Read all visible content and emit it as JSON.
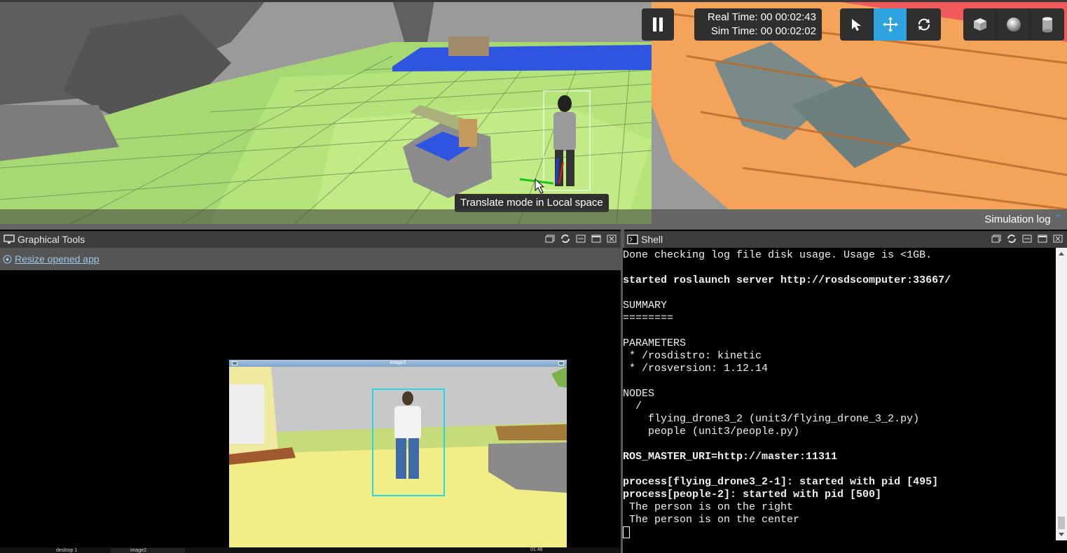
{
  "viewport": {
    "real_time": "Real Time: 00 00:02:43",
    "sim_time": "Sim Time: 00 00:02:02",
    "tooltip": "Translate mode in Local space",
    "simulation_log": "Simulation log",
    "tools": [
      "select-icon",
      "translate-icon",
      "rotate-icon"
    ],
    "shapes": [
      "box-icon",
      "sphere-icon",
      "cylinder-icon"
    ],
    "active_color": "#2ea3df"
  },
  "graphical_tools": {
    "title": "Graphical Tools",
    "resize_link": "Resize opened app",
    "image_window_title": "image2",
    "taskbar_items": [
      "desktop 1",
      "image2"
    ],
    "taskbar_time": "01:46"
  },
  "shell": {
    "title": "Shell",
    "lines": [
      {
        "text": "Done checking log file disk usage. Usage is <1GB.",
        "bold": false
      },
      {
        "text": "",
        "bold": false
      },
      {
        "text": "started roslaunch server http://rosdscomputer:33667/",
        "bold": true
      },
      {
        "text": "",
        "bold": false
      },
      {
        "text": "SUMMARY",
        "bold": false
      },
      {
        "text": "========",
        "bold": false
      },
      {
        "text": "",
        "bold": false
      },
      {
        "text": "PARAMETERS",
        "bold": false
      },
      {
        "text": " * /rosdistro: kinetic",
        "bold": false
      },
      {
        "text": " * /rosversion: 1.12.14",
        "bold": false
      },
      {
        "text": "",
        "bold": false
      },
      {
        "text": "NODES",
        "bold": false
      },
      {
        "text": "  /",
        "bold": false
      },
      {
        "text": "    flying_drone3_2 (unit3/flying_drone_3_2.py)",
        "bold": false
      },
      {
        "text": "    people (unit3/people.py)",
        "bold": false
      },
      {
        "text": "",
        "bold": false
      },
      {
        "text": "ROS_MASTER_URI=http://master:11311",
        "bold": true
      },
      {
        "text": "",
        "bold": false
      },
      {
        "text": "process[flying_drone3_2-1]: started with pid [495]",
        "bold": true
      },
      {
        "text": "process[people-2]: started with pid [500]",
        "bold": true
      },
      {
        "text": " The person is on the right",
        "bold": false
      },
      {
        "text": " The person is on the center",
        "bold": false
      }
    ]
  }
}
